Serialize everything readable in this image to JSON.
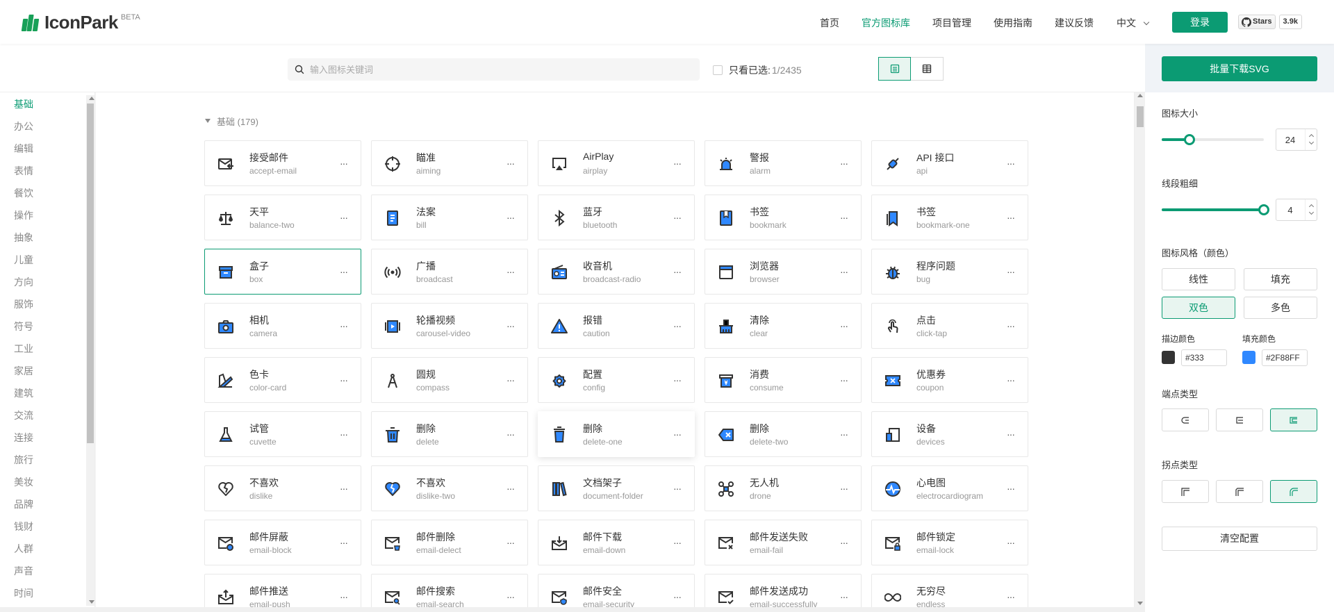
{
  "brand": {
    "name": "IconPark",
    "badge": "BETA",
    "color": "#0b9b73"
  },
  "nav": {
    "items": [
      "首页",
      "官方图标库",
      "项目管理",
      "使用指南",
      "建议反馈"
    ],
    "active_index": 1,
    "lang": "中文",
    "login": "登录",
    "github_stars_label": "Stars",
    "github_stars_count": "3.9k"
  },
  "search": {
    "placeholder": "输入图标关键词"
  },
  "filter": {
    "label": "只看已选:",
    "count": "1/2435"
  },
  "categories": [
    "基础",
    "办公",
    "编辑",
    "表情",
    "餐饮",
    "操作",
    "抽象",
    "儿童",
    "方向",
    "服饰",
    "符号",
    "工业",
    "家居",
    "建筑",
    "交流",
    "连接",
    "旅行",
    "美妆",
    "品牌",
    "钱财",
    "人群",
    "声音",
    "时间"
  ],
  "active_category": "基础",
  "section": {
    "title": "基础 (179)"
  },
  "icons": [
    {
      "zh": "接受邮件",
      "en": "accept-email",
      "icon": "mail-in-icon"
    },
    {
      "zh": "瞄准",
      "en": "aiming",
      "icon": "crosshair-icon"
    },
    {
      "zh": "AirPlay",
      "en": "airplay",
      "icon": "airplay-icon"
    },
    {
      "zh": "警报",
      "en": "alarm",
      "icon": "siren-icon"
    },
    {
      "zh": "API 接口",
      "en": "api",
      "icon": "plug-icon"
    },
    {
      "zh": "天平",
      "en": "balance-two",
      "icon": "scale-icon"
    },
    {
      "zh": "法案",
      "en": "bill",
      "icon": "bill-icon"
    },
    {
      "zh": "蓝牙",
      "en": "bluetooth",
      "icon": "bluetooth-icon"
    },
    {
      "zh": "书签",
      "en": "bookmark",
      "icon": "bookmark-icon"
    },
    {
      "zh": "书签",
      "en": "bookmark-one",
      "icon": "bookmark-one-icon"
    },
    {
      "zh": "盒子",
      "en": "box",
      "icon": "box-icon"
    },
    {
      "zh": "广播",
      "en": "broadcast",
      "icon": "broadcast-icon"
    },
    {
      "zh": "收音机",
      "en": "broadcast-radio",
      "icon": "radio-icon"
    },
    {
      "zh": "浏览器",
      "en": "browser",
      "icon": "browser-icon"
    },
    {
      "zh": "程序问题",
      "en": "bug",
      "icon": "bug-icon"
    },
    {
      "zh": "相机",
      "en": "camera",
      "icon": "camera-icon"
    },
    {
      "zh": "轮播视频",
      "en": "carousel-video",
      "icon": "carousel-video-icon"
    },
    {
      "zh": "报错",
      "en": "caution",
      "icon": "warning-icon"
    },
    {
      "zh": "清除",
      "en": "clear",
      "icon": "clear-icon"
    },
    {
      "zh": "点击",
      "en": "click-tap",
      "icon": "tap-icon"
    },
    {
      "zh": "色卡",
      "en": "color-card",
      "icon": "color-card-icon"
    },
    {
      "zh": "圆规",
      "en": "compass",
      "icon": "compass-icon"
    },
    {
      "zh": "配置",
      "en": "config",
      "icon": "gear-icon"
    },
    {
      "zh": "消费",
      "en": "consume",
      "icon": "consume-icon"
    },
    {
      "zh": "优惠券",
      "en": "coupon",
      "icon": "coupon-icon"
    },
    {
      "zh": "试管",
      "en": "cuvette",
      "icon": "flask-icon"
    },
    {
      "zh": "删除",
      "en": "delete",
      "icon": "trash-icon"
    },
    {
      "zh": "删除",
      "en": "delete-one",
      "icon": "trash-one-icon"
    },
    {
      "zh": "删除",
      "en": "delete-two",
      "icon": "backspace-icon"
    },
    {
      "zh": "设备",
      "en": "devices",
      "icon": "devices-icon"
    },
    {
      "zh": "不喜欢",
      "en": "dislike",
      "icon": "broken-heart-icon"
    },
    {
      "zh": "不喜欢",
      "en": "dislike-two",
      "icon": "broken-heart-filled-icon"
    },
    {
      "zh": "文档架子",
      "en": "document-folder",
      "icon": "book-shelf-icon"
    },
    {
      "zh": "无人机",
      "en": "drone",
      "icon": "drone-icon"
    },
    {
      "zh": "心电图",
      "en": "electrocardiogram",
      "icon": "ecg-icon"
    },
    {
      "zh": "邮件屏蔽",
      "en": "email-block",
      "icon": "mail-block-icon"
    },
    {
      "zh": "邮件删除",
      "en": "email-delect",
      "icon": "mail-delete-icon"
    },
    {
      "zh": "邮件下载",
      "en": "email-down",
      "icon": "mail-down-icon"
    },
    {
      "zh": "邮件发送失败",
      "en": "email-fail",
      "icon": "mail-fail-icon"
    },
    {
      "zh": "邮件锁定",
      "en": "email-lock",
      "icon": "mail-lock-icon"
    },
    {
      "zh": "邮件推送",
      "en": "email-push",
      "icon": "mail-push-icon"
    },
    {
      "zh": "邮件搜索",
      "en": "email-search",
      "icon": "mail-search-icon"
    },
    {
      "zh": "邮件安全",
      "en": "email-security",
      "icon": "mail-security-icon"
    },
    {
      "zh": "邮件发送成功",
      "en": "email-successfully",
      "icon": "mail-success-icon"
    },
    {
      "zh": "无穷尽",
      "en": "endless",
      "icon": "infinity-icon"
    }
  ],
  "selected_icon": "box",
  "hovered_icon": "delete-one",
  "panel": {
    "download_label": "批量下载SVG",
    "size_label": "图标大小",
    "size_value": "24",
    "size_fraction": 0.27,
    "stroke_label": "线段粗细",
    "stroke_value": "4",
    "stroke_fraction": 1.0,
    "style_label": "图标风格（颜色）",
    "styles": [
      "线性",
      "填充",
      "双色",
      "多色"
    ],
    "active_style": "双色",
    "stroke_color_label": "描边颜色",
    "stroke_color": "#333",
    "fill_color_label": "填充颜色",
    "fill_color": "#2F88FF",
    "linecap_label": "端点类型",
    "linejoin_label": "拐点类型",
    "clear_label": "清空配置"
  },
  "colors": {
    "accent": "#0b9b73",
    "icon_stroke": "#333333",
    "icon_fill": "#2F88FF"
  }
}
